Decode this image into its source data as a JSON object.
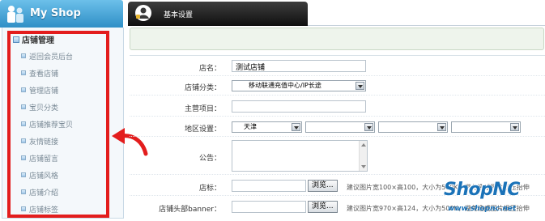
{
  "sidebar": {
    "shop_title": "My Shop",
    "group_title": "店铺管理",
    "items": [
      {
        "label": "返回会员后台"
      },
      {
        "label": "查看店铺"
      },
      {
        "label": "管理店铺"
      },
      {
        "label": "宝贝分类"
      },
      {
        "label": "店铺推荐宝贝"
      },
      {
        "label": "友情链接"
      },
      {
        "label": "店铺留言"
      },
      {
        "label": "店铺风格"
      },
      {
        "label": "店铺介绍"
      },
      {
        "label": "店铺标签"
      }
    ]
  },
  "tabs": [
    {
      "label": "基本设置"
    }
  ],
  "form": {
    "shop_name": {
      "label": "店名：",
      "value": "测试店铺"
    },
    "category": {
      "label": "店铺分类：",
      "value": "移动联通充值中心/IP长途"
    },
    "main_business": {
      "label": "主营项目：",
      "value": ""
    },
    "region": {
      "label": "地区设置：",
      "province": "天津"
    },
    "announcement": {
      "label": "公告：",
      "value": ""
    },
    "logo": {
      "label": "店标：",
      "browse_label": "浏览...",
      "hint": "建议图片宽100×高100，大小为500K，避免造成图片损压抬伸"
    },
    "banner": {
      "label": "店铺头部banner：",
      "browse_label": "浏览...",
      "hint": "建议图片宽970×高124，大小为500K，避免造成图片损压抬伸"
    }
  },
  "watermark": {
    "brand": "ShopNC",
    "url": "www.shopnc.net"
  },
  "colors": {
    "accent_red": "#e31d1d",
    "tab_dark": "#1a1a1a",
    "brand_blue": "#1a72b8"
  }
}
